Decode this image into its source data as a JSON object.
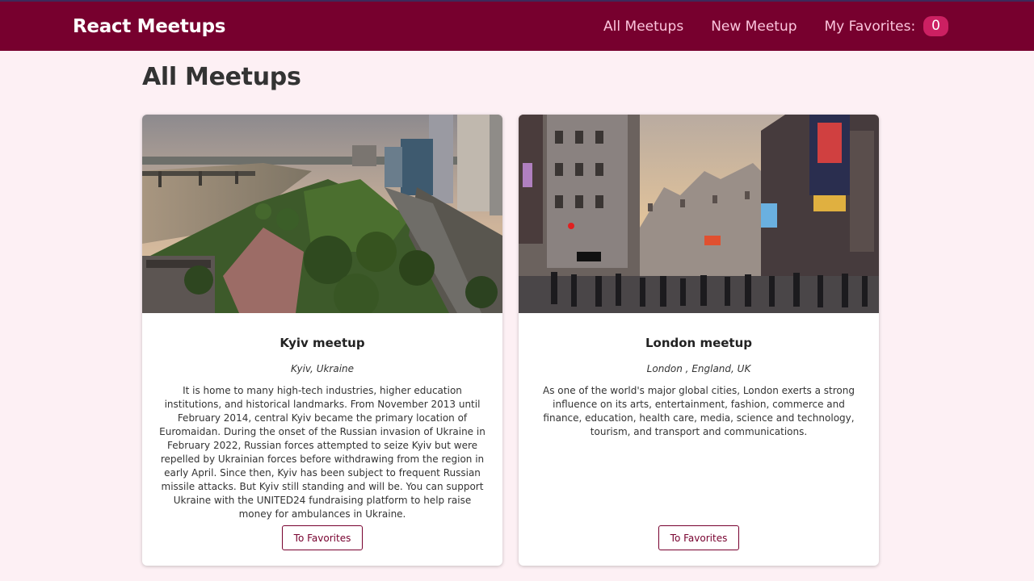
{
  "header": {
    "logo": "React Meetups",
    "nav": [
      {
        "label": "All Meetups"
      },
      {
        "label": "New Meetup"
      },
      {
        "label": "My Favorites:"
      }
    ],
    "favorites_count": "0"
  },
  "page": {
    "title": "All Meetups"
  },
  "meetups": [
    {
      "title": "Kyiv meetup",
      "address": "Kyiv, Ukraine",
      "description": "It is home to many high-tech industries, higher education institutions, and historical landmarks. From November 2013 until February 2014, central Kyiv became the primary location of Euromaidan. During the onset of the Russian invasion of Ukraine in February 2022, Russian forces attempted to seize Kyiv but were repelled by Ukrainian forces before withdrawing from the region in early April. Since then, Kyiv has been subject to frequent Russian missile attacks. But Kyiv still standing and will be. You can support Ukraine with the UNITED24 fundraising platform to help raise money for ambulances in Ukraine.",
      "button": "To Favorites"
    },
    {
      "title": "London meetup",
      "address": "London , England, UK",
      "description": "As one of the world's major global cities, London exerts a strong influence on its arts, entertainment, fashion, commerce and finance, education, health care, media, science and technology, tourism, and transport and communications.",
      "button": "To Favorites"
    }
  ],
  "colors": {
    "header_bg": "#77002e",
    "page_bg": "#fdf0f4",
    "badge_bg": "#cc2062",
    "nav_text": "#fcc5dd"
  }
}
